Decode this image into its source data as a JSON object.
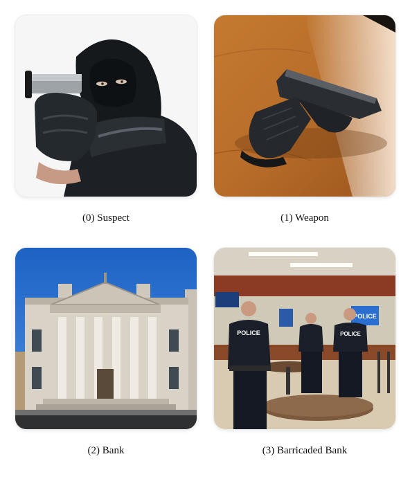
{
  "panels": [
    {
      "caption": "(0) Suspect"
    },
    {
      "caption": "(1) Weapon"
    },
    {
      "caption": "(2) Bank"
    },
    {
      "caption": "(3) Barricaded Bank",
      "signs": [
        "POLICE",
        "POLICE"
      ],
      "wall_sign": "POLICE"
    }
  ]
}
